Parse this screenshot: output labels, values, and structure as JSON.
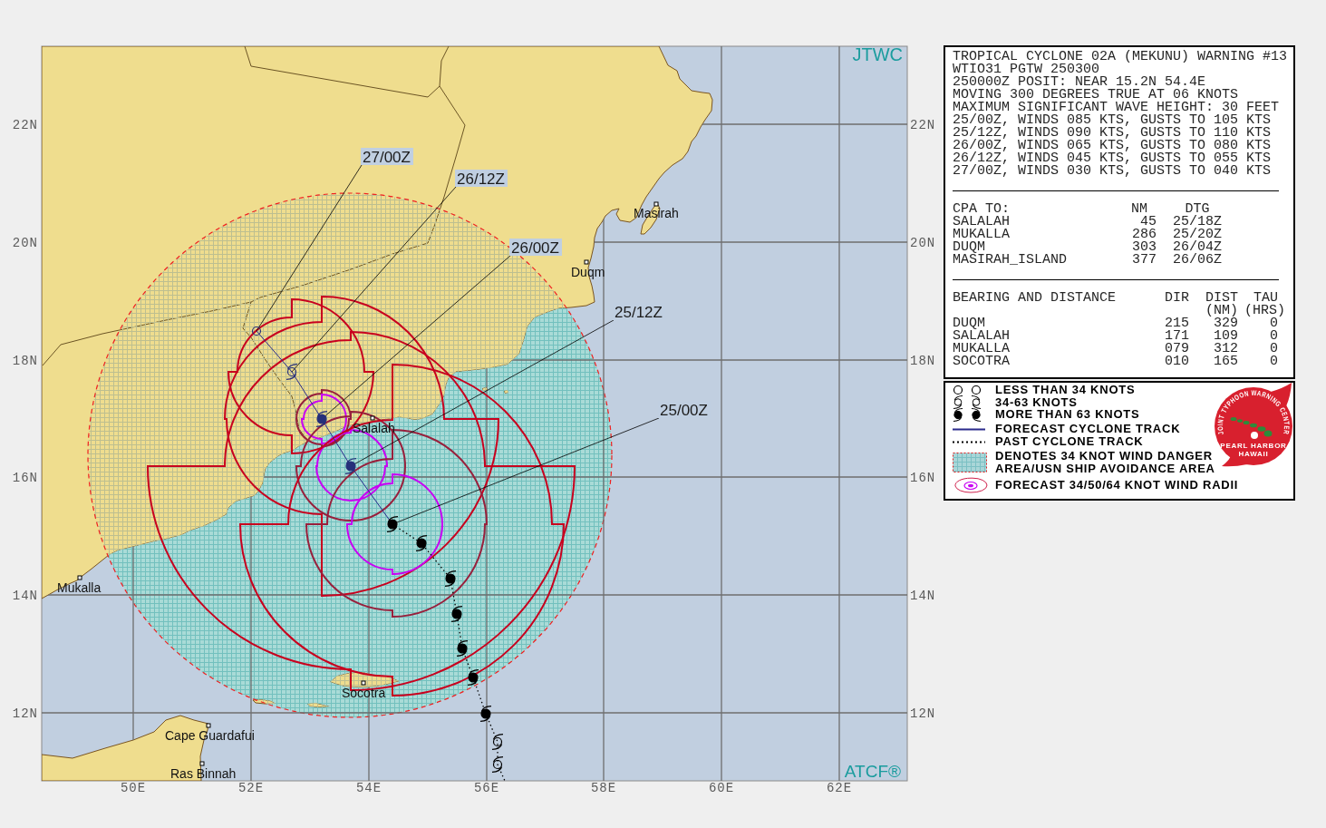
{
  "map": {
    "agency_mark": "JTWC",
    "system_mark": "ATCF®",
    "lat_labels_left": [
      "22N",
      "20N",
      "18N",
      "16N",
      "14N",
      "12N"
    ],
    "lat_labels_right": [
      "22N",
      "20N",
      "18N",
      "16N",
      "14N",
      "12N"
    ],
    "lon_labels": [
      "50E",
      "52E",
      "54E",
      "56E",
      "58E",
      "60E",
      "62E"
    ],
    "places": [
      {
        "name": "Masirah"
      },
      {
        "name": "Duqm"
      },
      {
        "name": "Salalah"
      },
      {
        "name": "Mukalla"
      },
      {
        "name": "Socotra"
      },
      {
        "name": "Cape Guardafui"
      },
      {
        "name": "Ras Binnah"
      }
    ],
    "forecast_positions": [
      {
        "label": "27/00Z",
        "kind": "weak"
      },
      {
        "label": "26/12Z",
        "kind": "moderate"
      },
      {
        "label": "26/00Z",
        "kind": "strong"
      },
      {
        "label": "25/12Z",
        "kind": "strong"
      }
    ],
    "current_position": {
      "label": "25/00Z",
      "kind": "strong"
    },
    "past_track": [
      {
        "kind": "strong"
      },
      {
        "kind": "strong"
      },
      {
        "kind": "strong"
      },
      {
        "kind": "strong"
      },
      {
        "kind": "strong"
      },
      {
        "kind": "strong"
      },
      {
        "kind": "moderate"
      },
      {
        "kind": "moderate"
      }
    ]
  },
  "warning": {
    "lines": [
      "TROPICAL CYCLONE 02A (MEKUNU) WARNING #13",
      "WTIO31 PGTW 250300",
      "250000Z POSIT: NEAR 15.2N 54.4E",
      "MOVING 300 DEGREES TRUE AT 06 KNOTS",
      "MAXIMUM SIGNIFICANT WAVE HEIGHT: 30 FEET",
      "25/00Z, WINDS 085 KTS, GUSTS TO 105 KTS",
      "25/12Z, WINDS 090 KTS, GUSTS TO 110 KTS",
      "26/00Z, WINDS 065 KTS, GUSTS TO 080 KTS",
      "26/12Z, WINDS 045 KTS, GUSTS TO 055 KTS",
      "27/00Z, WINDS 030 KTS, GUSTS TO 040 KTS"
    ],
    "cpa": {
      "columns": [
        "CPA TO:",
        "NM",
        "DTG"
      ],
      "rows": [
        {
          "place": "SALALAH",
          "nm": "45",
          "dtg": "25/18Z"
        },
        {
          "place": "MUKALLA",
          "nm": "286",
          "dtg": "25/20Z"
        },
        {
          "place": "DUQM",
          "nm": "303",
          "dtg": "26/04Z"
        },
        {
          "place": "MASIRAH_ISLAND",
          "nm": "377",
          "dtg": "26/06Z"
        }
      ]
    },
    "bearing": {
      "columns": [
        "BEARING AND DISTANCE",
        "DIR",
        "DIST",
        "TAU"
      ],
      "units": [
        "(NM)",
        "(HRS)"
      ],
      "rows": [
        {
          "place": "DUQM",
          "dir": "215",
          "dist": "329",
          "tau": "0"
        },
        {
          "place": "SALALAH",
          "dir": "171",
          "dist": "109",
          "tau": "0"
        },
        {
          "place": "MUKALLA",
          "dir": "079",
          "dist": "312",
          "tau": "0"
        },
        {
          "place": "SOCOTRA",
          "dir": "010",
          "dist": "165",
          "tau": "0"
        }
      ]
    }
  },
  "legend": {
    "items": [
      {
        "kind": "weak",
        "label": [
          "LESS THAN 34 KNOTS"
        ]
      },
      {
        "kind": "moderate",
        "label": [
          "34-63 KNOTS"
        ]
      },
      {
        "kind": "strong",
        "label": [
          "MORE THAN 63 KNOTS"
        ]
      },
      {
        "kind": "forecast_track",
        "label": [
          "FORECAST CYCLONE TRACK"
        ]
      },
      {
        "kind": "past_track",
        "label": [
          "PAST CYCLONE TRACK"
        ]
      },
      {
        "kind": "danger_area",
        "label": [
          "DENOTES 34 KNOT WIND DANGER",
          "AREA/USN SHIP AVOIDANCE AREA"
        ]
      },
      {
        "kind": "wind_radii",
        "label": [
          "FORECAST 34/50/64 KNOT WIND RADII"
        ]
      }
    ],
    "logo": {
      "ring_text": "JOINT TYPHOON WARNING CENTER",
      "lines": [
        "PEARL HARBOR",
        "HAWAII"
      ]
    }
  }
}
